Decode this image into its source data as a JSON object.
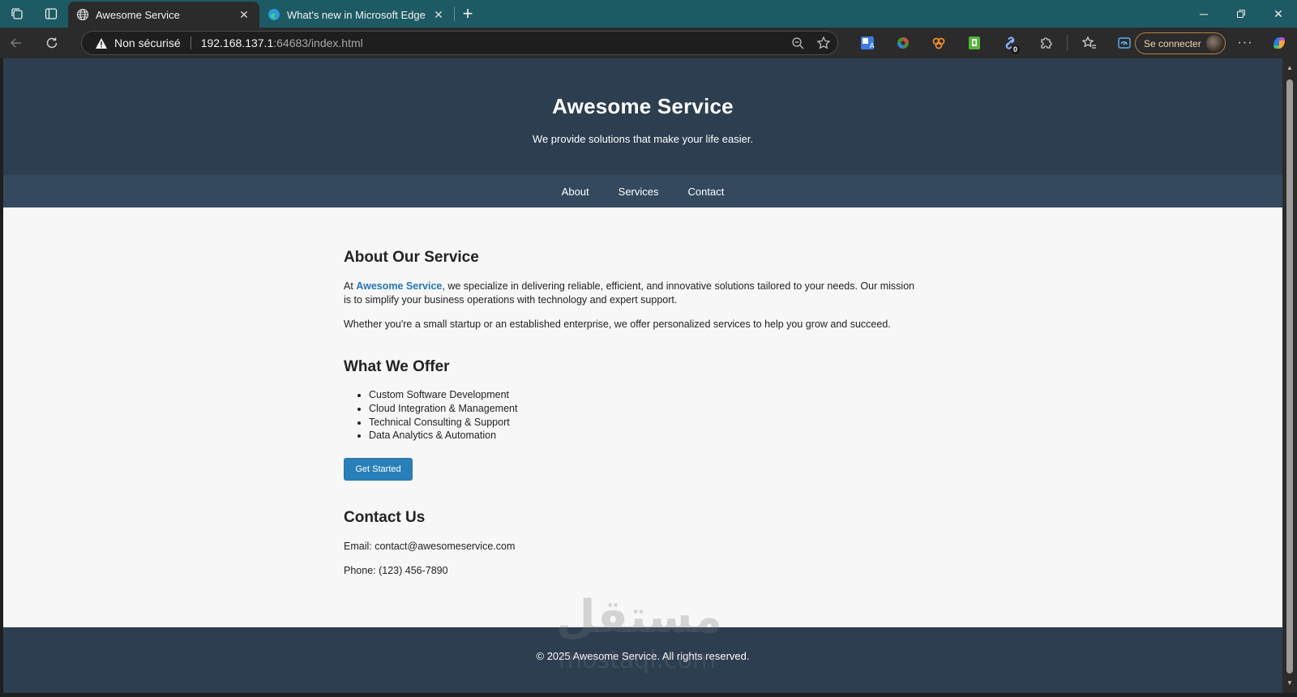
{
  "browser": {
    "tabs": [
      {
        "title": "Awesome Service",
        "active": true
      },
      {
        "title": "What's new in Microsoft Edge",
        "active": false
      }
    ],
    "address": {
      "security_label": "Non sécurisé",
      "url_host": "192.168.137.1",
      "url_rest": ":64683/index.html"
    },
    "extension_badge": "0",
    "signin_label": "Se connecter",
    "more_label": "···"
  },
  "site": {
    "title": "Awesome Service",
    "tagline": "We provide solutions that make your life easier.",
    "nav": [
      "About",
      "Services",
      "Contact"
    ],
    "about": {
      "heading": "About Our Service",
      "p1_prefix": "At ",
      "p1_brand": "Awesome Service",
      "p1_suffix": ", we specialize in delivering reliable, efficient, and innovative solutions tailored to your needs. Our mission is to simplify your business operations with technology and expert support.",
      "p2": "Whether you're a small startup or an established enterprise, we offer personalized services to help you grow and succeed."
    },
    "services": {
      "heading": "What We Offer",
      "items": [
        "Custom Software Development",
        "Cloud Integration & Management",
        "Technical Consulting & Support",
        "Data Analytics & Automation"
      ],
      "button": "Get Started"
    },
    "contact": {
      "heading": "Contact Us",
      "email": "Email: contact@awesomeservice.com",
      "phone": "Phone: (123) 456-7890"
    },
    "footer": "© 2025 Awesome Service. All rights reserved."
  },
  "watermark": {
    "arabic": "مستقل",
    "latin": "mostaql.com"
  },
  "colors": {
    "tabstrip": "#1d5a63",
    "header": "#2c3e50",
    "nav": "#34495e",
    "accent": "#2980b9",
    "page_bg": "#f7f7f7"
  }
}
